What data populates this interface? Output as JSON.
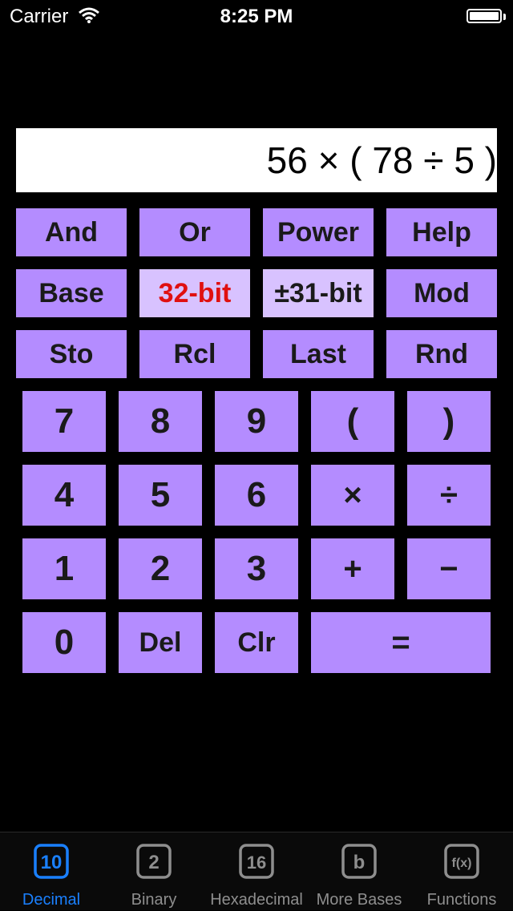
{
  "status_bar": {
    "carrier": "Carrier",
    "time": "8:25 PM"
  },
  "display": {
    "expression": "56 × ( 78 ÷ 5 )"
  },
  "function_keys": {
    "and": "And",
    "or": "Or",
    "power": "Power",
    "help": "Help",
    "base": "Base",
    "bit32": "32-bit",
    "signed31": "±31-bit",
    "mod": "Mod",
    "sto": "Sto",
    "rcl": "Rcl",
    "last": "Last",
    "rnd": "Rnd"
  },
  "keypad": {
    "seven": "7",
    "eight": "8",
    "nine": "9",
    "lparen": "(",
    "rparen": ")",
    "four": "4",
    "five": "5",
    "six": "6",
    "multiply": "×",
    "divide": "÷",
    "one": "1",
    "two": "2",
    "three": "3",
    "plus": "+",
    "minus": "−",
    "zero": "0",
    "del": "Del",
    "clr": "Clr",
    "equals": "="
  },
  "tabs": [
    {
      "label": "Decimal",
      "icon": "10",
      "active": true
    },
    {
      "label": "Binary",
      "icon": "2",
      "active": false
    },
    {
      "label": "Hexadecimal",
      "icon": "16",
      "active": false
    },
    {
      "label": "More Bases",
      "icon": "b",
      "active": false
    },
    {
      "label": "Functions",
      "icon": "f(x)",
      "active": false
    }
  ],
  "colors": {
    "key": "#b48cff",
    "key_highlight": "#d8c2ff",
    "active_tab": "#1a80ff",
    "inactive_tab": "#8e8e8e",
    "bit_mode_text": "#e01010"
  }
}
